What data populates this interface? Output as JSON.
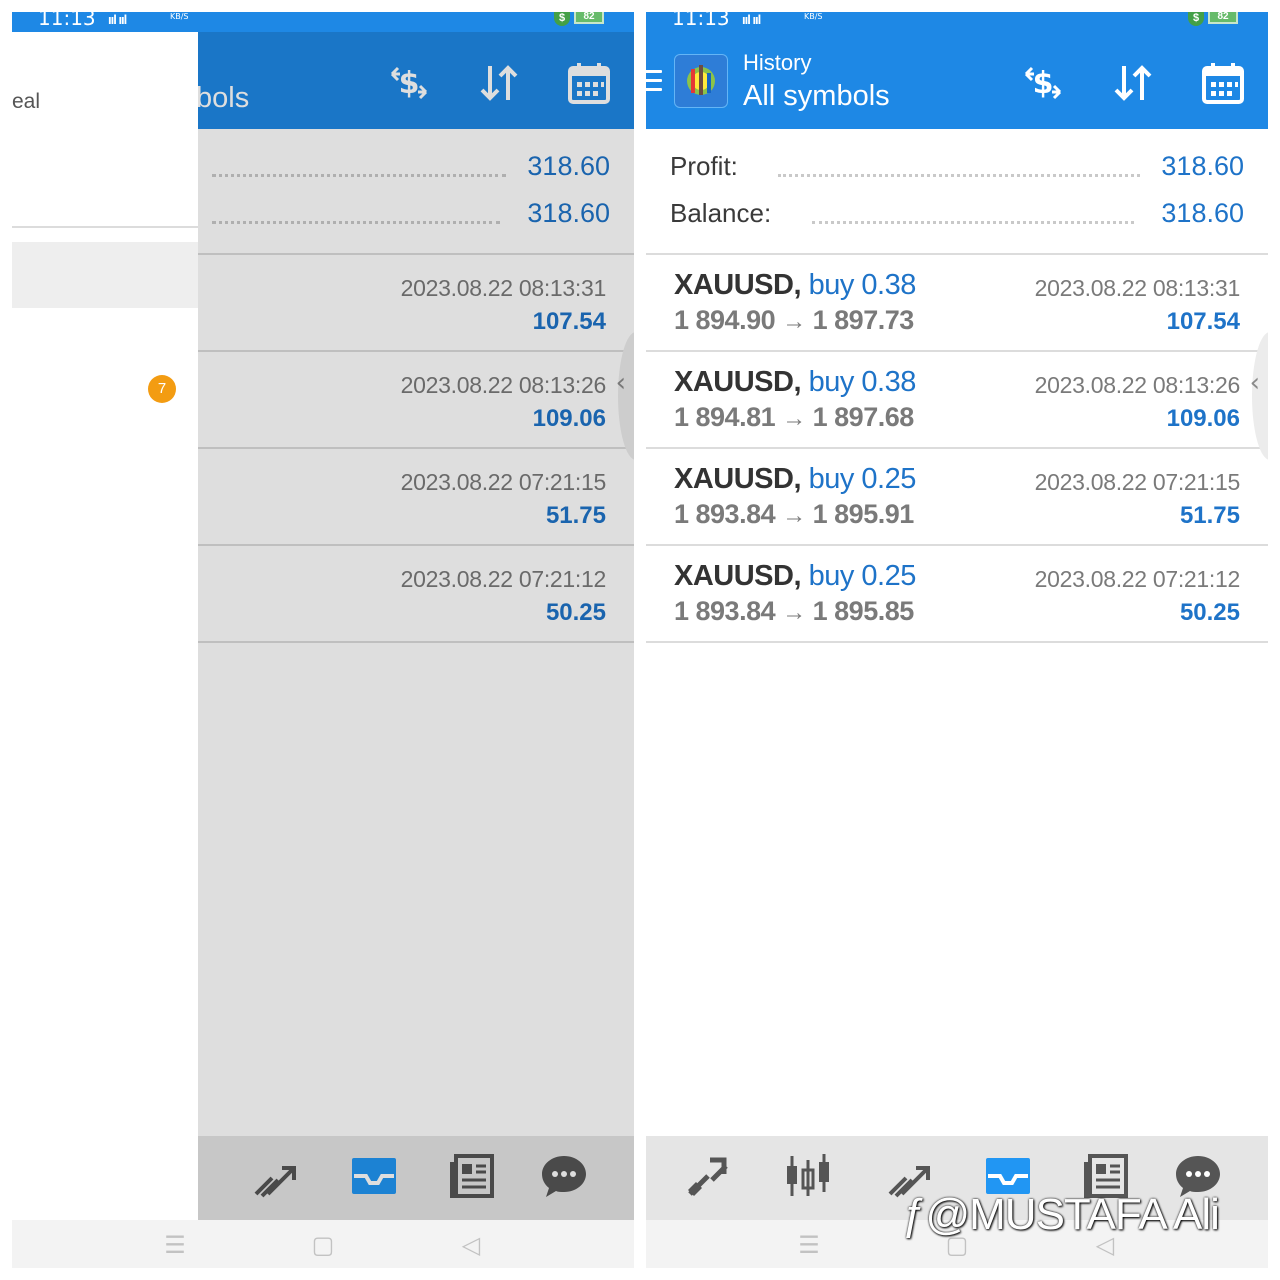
{
  "status_bar": {
    "time": "11:13",
    "signal": "ııl ııl",
    "speed": "KB/S",
    "battery": "82",
    "shield": "$"
  },
  "app_bar": {
    "subtitle": "History",
    "title": "All symbols",
    "title_partial": "bols",
    "icons": [
      "currency-exchange-icon",
      "sort-icon",
      "calendar-icon"
    ]
  },
  "summary": {
    "profit_label": "Profit:",
    "profit_value": "318.60",
    "balance_label": "Balance:",
    "balance_value": "318.60"
  },
  "deals": [
    {
      "symbol": "XAUUSD,",
      "side": "buy 0.38",
      "open": "1 894.90",
      "arrow": "→",
      "close": "1 897.73",
      "time": "2023.08.22 08:13:31",
      "profit": "107.54"
    },
    {
      "symbol": "XAUUSD,",
      "side": "buy 0.38",
      "open": "1 894.81",
      "arrow": "→",
      "close": "1 897.68",
      "time": "2023.08.22 08:13:26",
      "profit": "109.06"
    },
    {
      "symbol": "XAUUSD,",
      "side": "buy 0.25",
      "open": "1 893.84",
      "arrow": "→",
      "close": "1 895.91",
      "time": "2023.08.22 07:21:15",
      "profit": "51.75"
    },
    {
      "symbol": "XAUUSD,",
      "side": "buy 0.25",
      "open": "1 893.84",
      "arrow": "→",
      "close": "1 895.85",
      "time": "2023.08.22 07:21:12",
      "profit": "50.25"
    }
  ],
  "drawer": {
    "item_text": "eal",
    "badge": "7"
  },
  "bottom_nav": {
    "icons": [
      "quotes-icon",
      "chart-icon",
      "trade-icon",
      "history-icon",
      "news-icon",
      "chat-icon"
    ],
    "active": "history-icon"
  },
  "system_nav": {
    "menu": "☰",
    "home": "▢",
    "back": "◁"
  },
  "watermark": "@MUSTAFA Ali",
  "colors": {
    "app_blue": "#1e88e5",
    "value_blue": "#1e73c8",
    "badge_orange": "#f39c12",
    "nav_active": "#2196f3"
  }
}
